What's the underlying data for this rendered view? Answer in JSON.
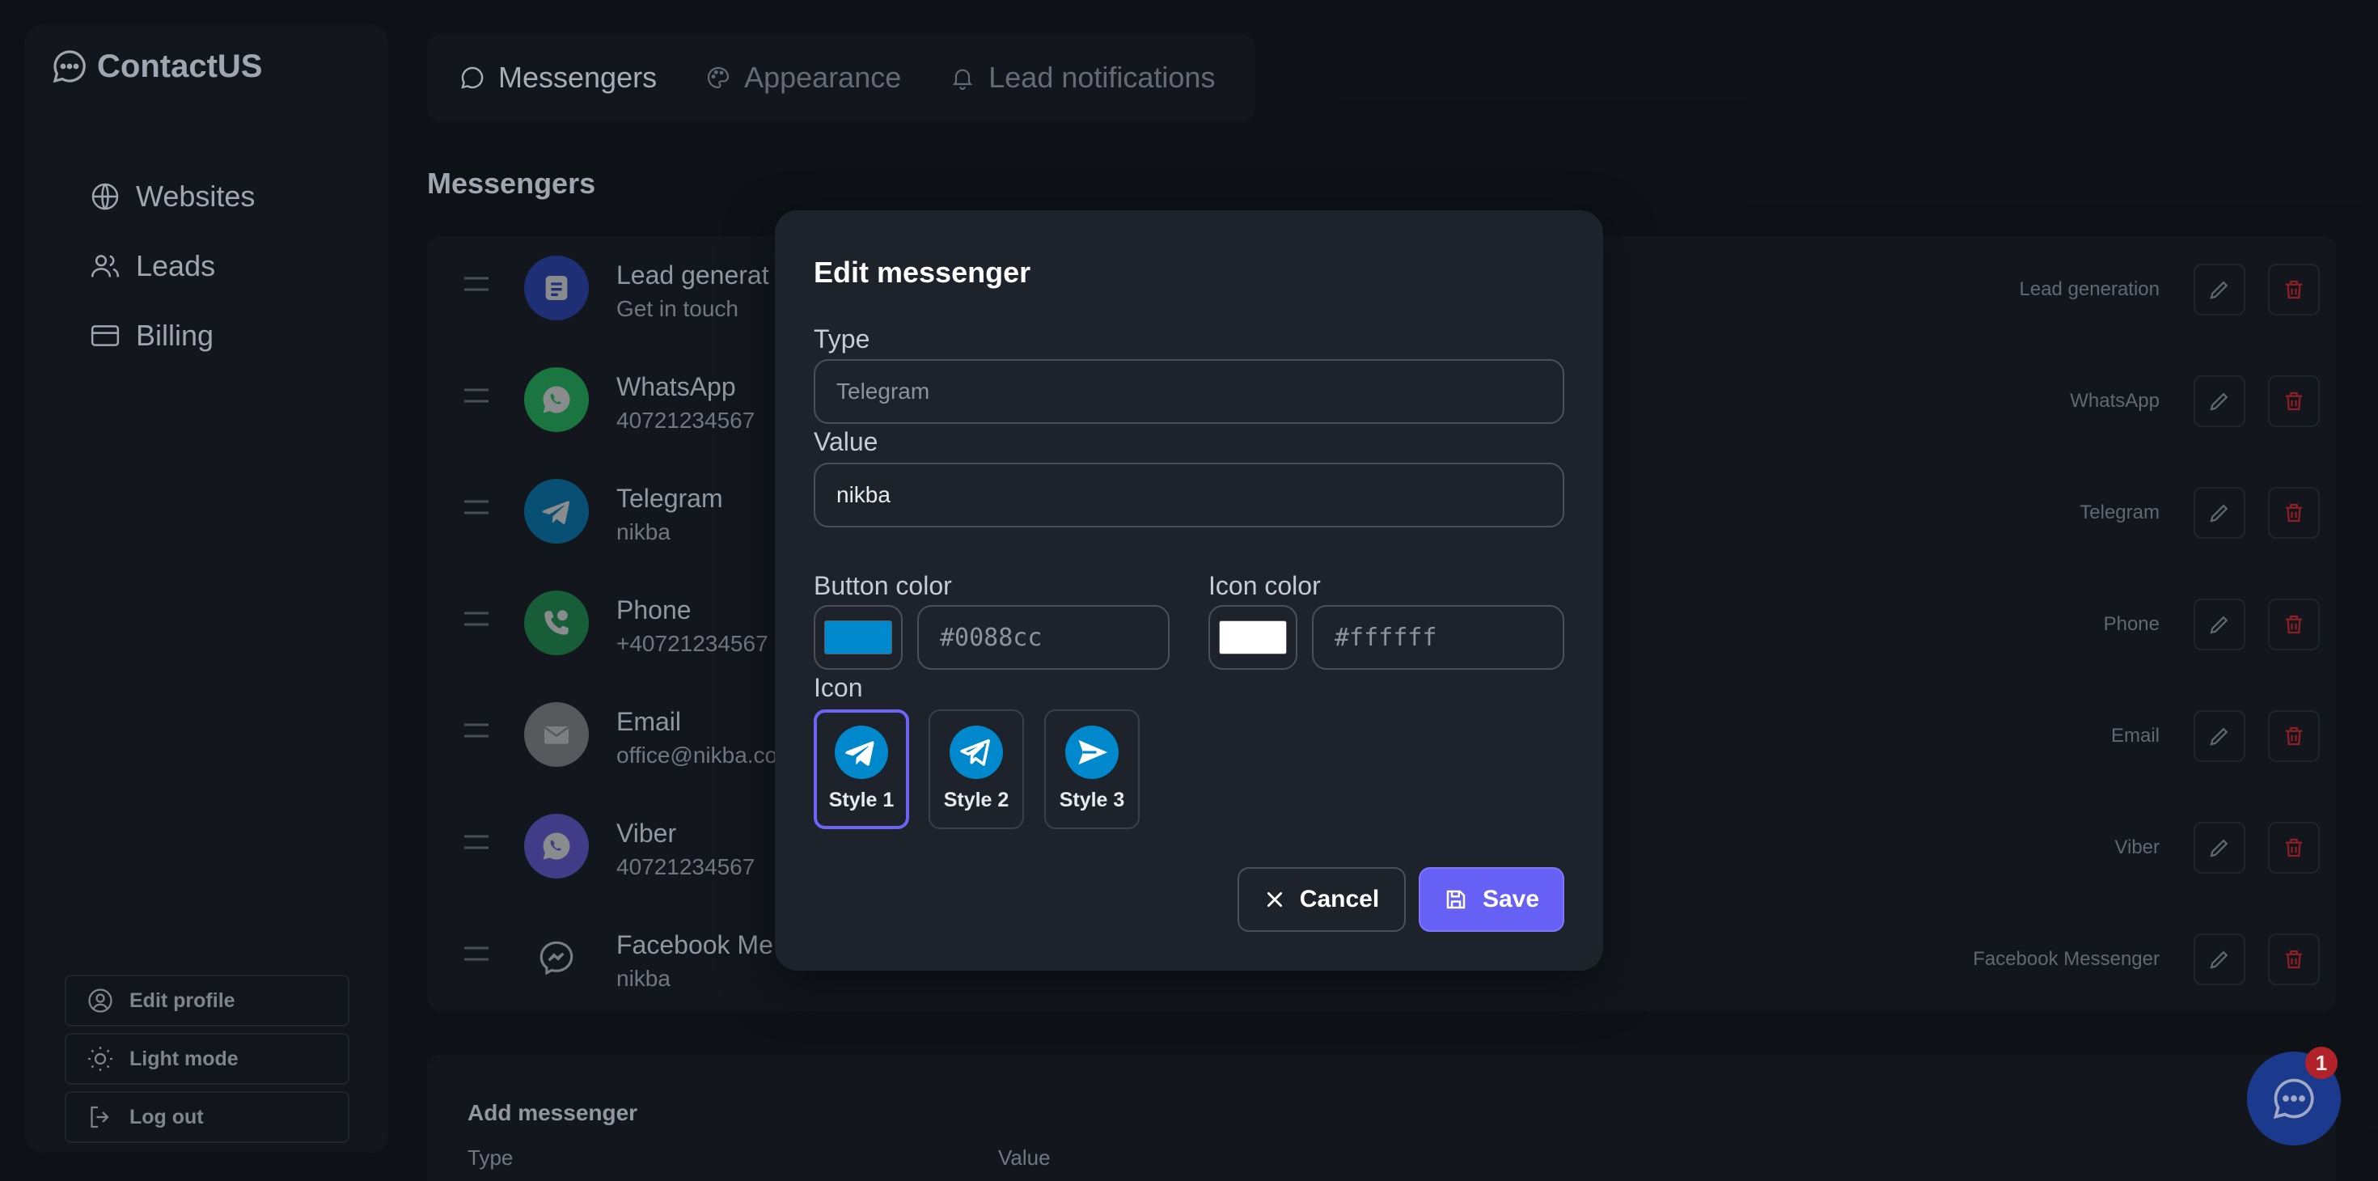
{
  "app": {
    "name": "ContactUS"
  },
  "sidebar": {
    "items": [
      {
        "label": "Websites",
        "icon": "globe-icon"
      },
      {
        "label": "Leads",
        "icon": "users-icon"
      },
      {
        "label": "Billing",
        "icon": "card-icon"
      }
    ],
    "bottom": [
      {
        "label": "Edit profile",
        "icon": "user-circle-icon"
      },
      {
        "label": "Light mode",
        "icon": "sun-icon"
      },
      {
        "label": "Log out",
        "icon": "logout-icon"
      }
    ]
  },
  "tabs": [
    {
      "label": "Messengers",
      "icon": "chat-bubble-icon",
      "active": true
    },
    {
      "label": "Appearance",
      "icon": "palette-icon",
      "active": false
    },
    {
      "label": "Lead notifications",
      "icon": "bell-icon",
      "active": false
    }
  ],
  "main": {
    "title": "Messengers",
    "messengers": [
      {
        "title": "Lead generat",
        "value": "Get in touch",
        "type": "Lead generation",
        "color": "#2b4ad0"
      },
      {
        "title": "WhatsApp",
        "value": "40721234567",
        "type": "WhatsApp",
        "color": "#25d366"
      },
      {
        "title": "Telegram",
        "value": "nikba",
        "type": "Telegram",
        "color": "#0088cc"
      },
      {
        "title": "Phone",
        "value": "+40721234567",
        "type": "Phone",
        "color": "#1fa855"
      },
      {
        "title": "Email",
        "value": "office@nikba.co",
        "type": "Email",
        "color": "#9a9a9a"
      },
      {
        "title": "Viber",
        "value": "40721234567",
        "type": "Viber",
        "color": "#7360f2"
      },
      {
        "title": "Facebook Me",
        "value": "nikba",
        "type": "Facebook Messenger",
        "color": "#151920"
      }
    ],
    "add": {
      "title": "Add messenger",
      "type_label": "Type",
      "value_label": "Value"
    }
  },
  "chat_widget": {
    "badge": "1"
  },
  "modal": {
    "title": "Edit messenger",
    "type_label": "Type",
    "type_value": "Telegram",
    "value_label": "Value",
    "value_value": "nikba",
    "button_color_label": "Button color",
    "button_color_value": "#0088cc",
    "icon_color_label": "Icon color",
    "icon_color_value": "#ffffff",
    "icon_label": "Icon",
    "icon_styles": [
      {
        "label": "Style 1",
        "selected": true
      },
      {
        "label": "Style 2",
        "selected": false
      },
      {
        "label": "Style 3",
        "selected": false
      }
    ],
    "cancel_label": "Cancel",
    "save_label": "Save"
  },
  "colors": {
    "accent": "#6760f4",
    "danger": "#c0262c",
    "telegram": "#0088cc"
  }
}
